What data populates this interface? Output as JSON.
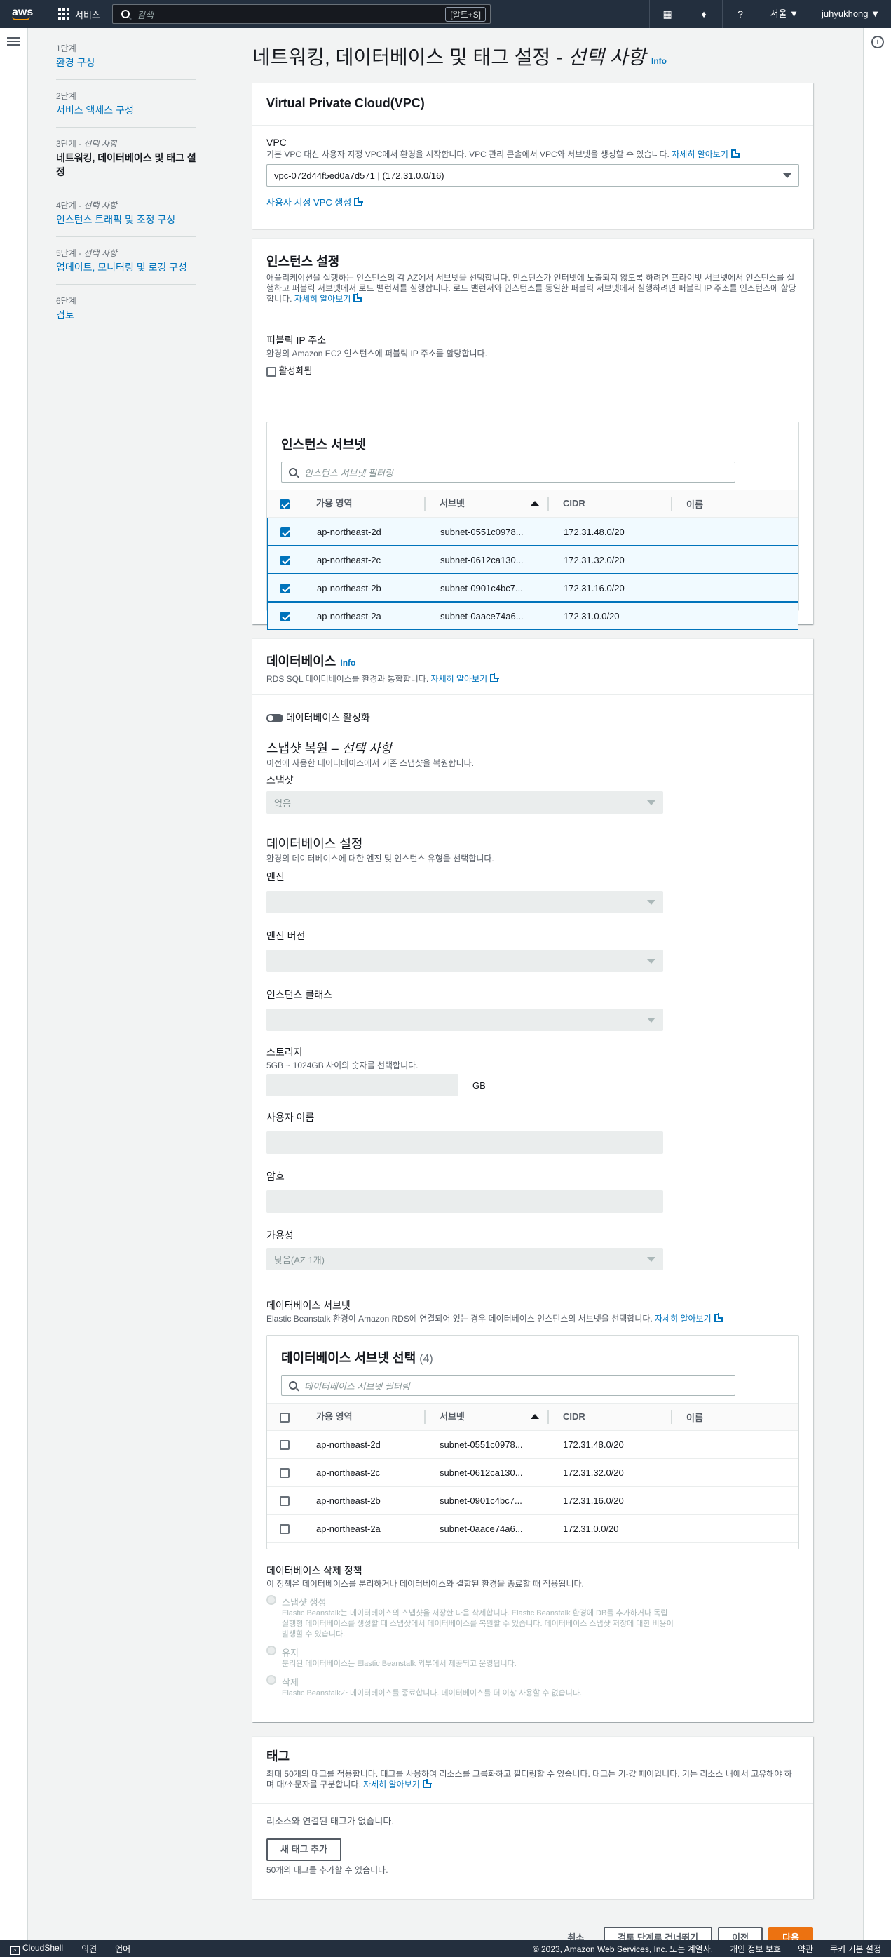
{
  "topnav": {
    "logo": "aws",
    "services": "서비스",
    "search_placeholder": "검색",
    "shortcut": "[알트+S]",
    "region": "서울 ▼",
    "user": "juhyukhong ▼"
  },
  "steps": [
    {
      "num": "1단계",
      "num_suffix": "",
      "label": "환경 구성",
      "active": false
    },
    {
      "num": "2단계",
      "num_suffix": "",
      "label": "서비스 액세스 구성",
      "active": false
    },
    {
      "num": "3단계 - ",
      "num_suffix": "선택 사항",
      "label": "네트워킹, 데이터베이스 및 태그 설정",
      "active": true
    },
    {
      "num": "4단계 - ",
      "num_suffix": "선택 사항",
      "label": "인스턴스 트래픽 및 조정 구성",
      "active": false
    },
    {
      "num": "5단계 - ",
      "num_suffix": "선택 사항",
      "label": "업데이트, 모니터링 및 로깅 구성",
      "active": false
    },
    {
      "num": "6단계",
      "num_suffix": "",
      "label": "검토",
      "active": false
    }
  ],
  "page": {
    "title": "네트워킹, 데이터베이스 및 태그 설정 - ",
    "title_italic": "선택 사항",
    "info": "Info"
  },
  "vpc": {
    "heading": "Virtual Private Cloud(VPC)",
    "label": "VPC",
    "desc": "기본 VPC 대신 사용자 지정 VPC에서 환경을 시작합니다. VPC 관리 콘솔에서 VPC와 서브넷을 생성할 수 있습니다.",
    "learn_more": "자세히 알아보기",
    "value": "vpc-072d44f5ed0a7d571 | (172.31.0.0/16)",
    "create_link": "사용자 지정 VPC 생성"
  },
  "instance": {
    "heading": "인스턴스 설정",
    "desc": "애플리케이션을 실행하는 인스턴스의 각 AZ에서 서브넷을 선택합니다. 인스턴스가 인터넷에 노출되지 않도록 하려면 프라이빗 서브넷에서 인스턴스를 실행하고 퍼블릭 서브넷에서 로드 밸런서를 실행합니다. 로드 밸런서와 인스턴스를 동일한 퍼블릭 서브넷에서 실행하려면 퍼블릭 IP 주소를 인스턴스에 할당합니다.",
    "learn_more": "자세히 알아보기",
    "public_ip_label": "퍼블릭 IP 주소",
    "public_ip_desc": "환경의 Amazon EC2 인스턴스에 퍼블릭 IP 주소를 할당합니다.",
    "activate": "활성화됨",
    "subnet_title": "인스턴스 서브넷",
    "filter_placeholder": "인스턴스 서브넷 필터링"
  },
  "table_headers": {
    "az": "가용 영역",
    "subnet": "서브넷",
    "cidr": "CIDR",
    "name": "이름"
  },
  "subnets": [
    {
      "az": "ap-northeast-2d",
      "subnet": "subnet-0551c0978...",
      "cidr": "172.31.48.0/20",
      "name": ""
    },
    {
      "az": "ap-northeast-2c",
      "subnet": "subnet-0612ca130...",
      "cidr": "172.31.32.0/20",
      "name": ""
    },
    {
      "az": "ap-northeast-2b",
      "subnet": "subnet-0901c4bc7...",
      "cidr": "172.31.16.0/20",
      "name": ""
    },
    {
      "az": "ap-northeast-2a",
      "subnet": "subnet-0aace74a6...",
      "cidr": "172.31.0.0/20",
      "name": ""
    }
  ],
  "database": {
    "heading": "데이터베이스",
    "info": "Info",
    "desc": "RDS SQL 데이터베이스를 환경과 통합합니다.",
    "learn_more": "자세히 알아보기",
    "toggle_label": "데이터베이스 활성화",
    "snapshot_title": "스냅샷 복원 – ",
    "snapshot_title_italic": "선택 사항",
    "snapshot_desc": "이전에 사용한 데이터베이스에서 기존 스냅샷을 복원합니다.",
    "snapshot_label": "스냅샷",
    "snapshot_value": "없음",
    "settings_title": "데이터베이스 설정",
    "settings_desc": "환경의 데이터베이스에 대한 엔진 및 인스턴스 유형을 선택합니다.",
    "engine": "엔진",
    "engine_version": "엔진 버전",
    "instance_class": "인스턴스 클래스",
    "storage": "스토리지",
    "storage_desc": "5GB ~ 1024GB 사이의 숫자를 선택합니다.",
    "storage_unit": "GB",
    "username": "사용자 이름",
    "password": "암호",
    "availability": "가용성",
    "availability_value": "낮음(AZ 1개)",
    "db_subnets": "데이터베이스 서브넷",
    "db_subnets_desc": "Elastic Beanstalk 환경이 Amazon RDS에 연결되어 있는 경우 데이터베이스 인스턴스의 서브넷을 선택합니다.",
    "db_subnet_select": "데이터베이스 서브넷 선택",
    "db_subnet_count": "(4)",
    "db_filter_placeholder": "데이터베이스 서브넷 필터링",
    "deletion_title": "데이터베이스 삭제 정책",
    "deletion_desc": "이 정책은 데이터베이스를 분리하거나 데이터베이스와 결합된 환경을 종료할 때 적용됩니다.",
    "opt1_label": "스냅샷 생성",
    "opt1_desc": "Elastic Beanstalk는 데이터베이스의 스냅샷을 저장한 다음 삭제합니다. Elastic Beanstalk 환경에 DB를 추가하거나 독립 실행형 데이터베이스를 생성할 때 스냅샷에서 데이터베이스를 복원할 수 있습니다. 데이터베이스 스냅샷 저장에 대한 비용이 발생할 수 있습니다.",
    "opt2_label": "유지",
    "opt2_desc": "분리된 데이터베이스는 Elastic Beanstalk 외부에서 제공되고 운영됩니다.",
    "opt3_label": "삭제",
    "opt3_desc": "Elastic Beanstalk가 데이터베이스를 종료합니다. 데이터베이스를 더 이상 사용할 수 없습니다."
  },
  "tags": {
    "heading": "태그",
    "desc": "최대 50개의 태그를 적용합니다. 태그를 사용하여 리소스를 그룹화하고 필터링할 수 있습니다. 태그는 키-값 페어입니다. 키는 리소스 내에서 고유해야 하며 대/소문자를 구분합니다.",
    "learn_more": "자세히 알아보기",
    "empty": "리소스와 연결된 태그가 없습니다.",
    "add_button": "새 태그 추가",
    "limit": "50개의 태그를 추가할 수 있습니다."
  },
  "actions": {
    "cancel": "취소",
    "skip": "검토 단계로 건너뛰기",
    "prev": "이전",
    "next": "다음"
  },
  "footer": {
    "cloudshell": "CloudShell",
    "feedback": "의견",
    "language": "언어",
    "copyright": "© 2023, Amazon Web Services, Inc. 또는 계열사.",
    "privacy": "개인 정보 보호",
    "terms": "약관",
    "cookies": "쿠키 기본 설정"
  }
}
